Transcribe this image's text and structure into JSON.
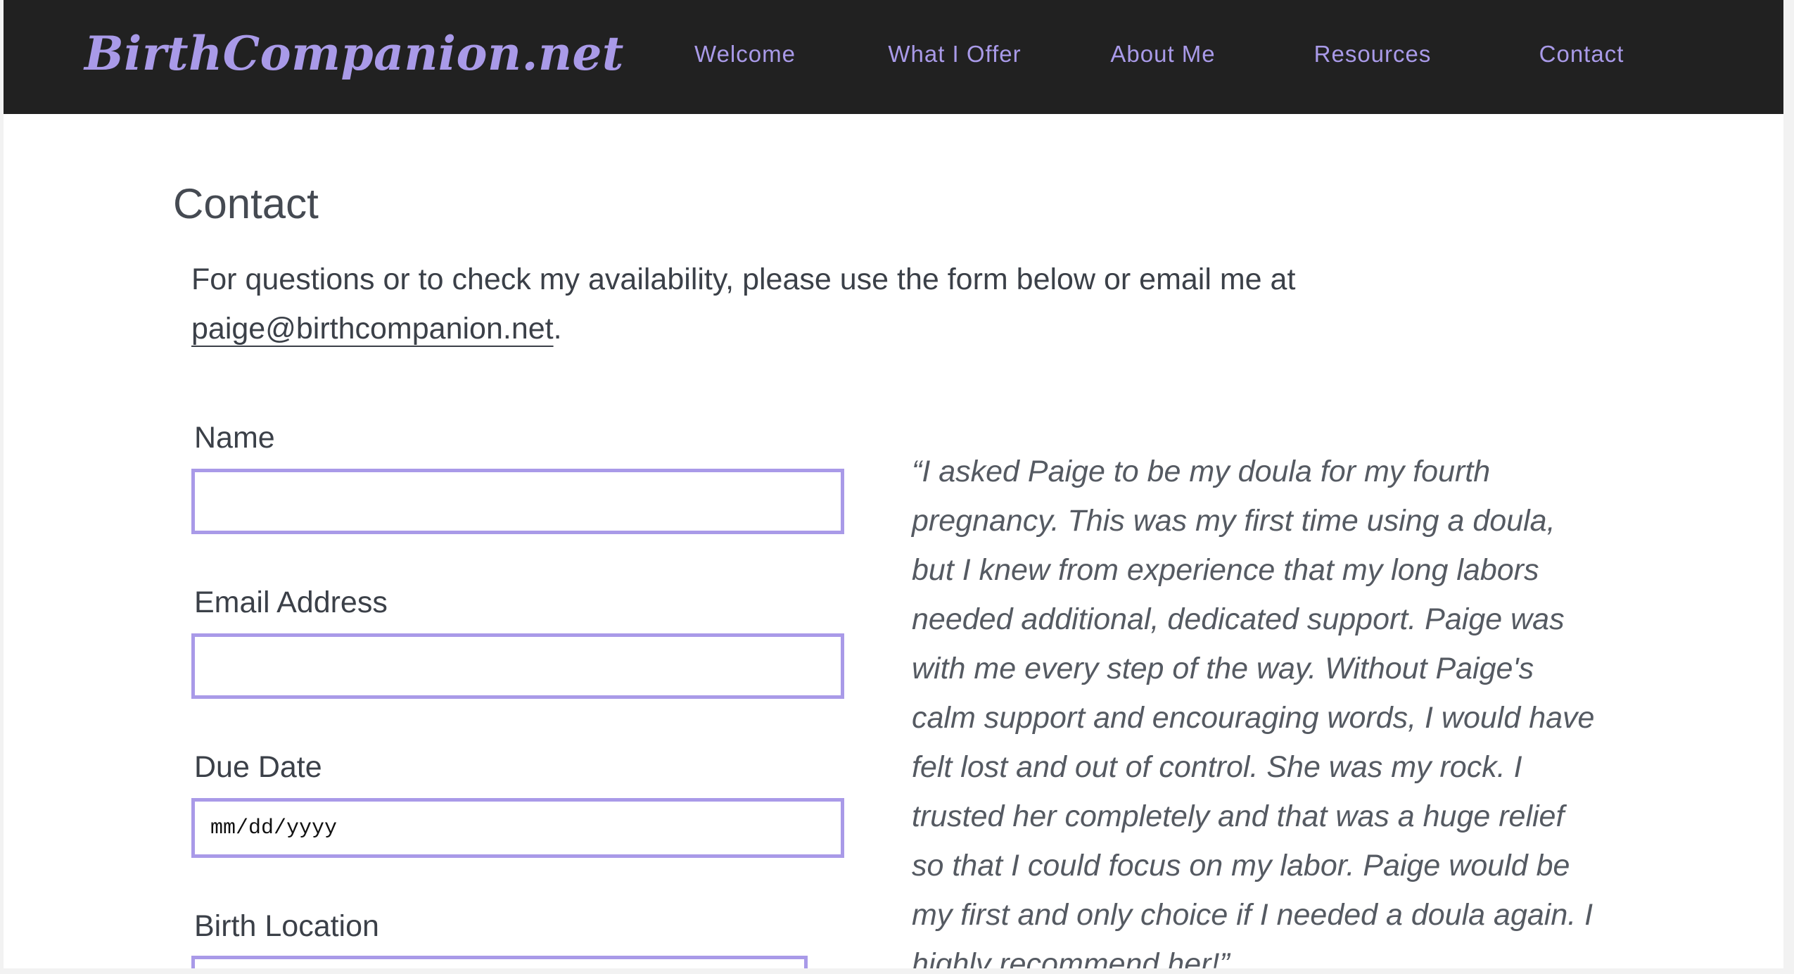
{
  "site": {
    "brand": "BirthCompanion.net"
  },
  "nav": {
    "items": [
      {
        "label": "Welcome"
      },
      {
        "label": "What I Offer"
      },
      {
        "label": "About Me"
      },
      {
        "label": "Resources"
      },
      {
        "label": "Contact"
      }
    ]
  },
  "main": {
    "title": "Contact",
    "intro": {
      "text": "For questions or to check my availability, please use the form below or email me at ",
      "email": "paige@birthcompanion.net",
      "suffix": "."
    },
    "form": {
      "name_label": "Name",
      "name_value": "",
      "email_label": "Email Address",
      "email_value": "",
      "due_date_label": "Due Date",
      "due_date_placeholder": "mm/dd/yyyy",
      "birth_location_label": "Birth Location",
      "birth_location_value": ""
    },
    "testimonial": "“I asked Paige to be my doula for my fourth pregnancy. This was my first time using a doula, but I knew from experience that my long labors needed additional, dedicated support. Paige was with me every step of the way. Without Paige's calm support and encouraging words, I would have felt lost and out of control. She was my rock. I trusted her completely and that was a huge relief so that I could focus on my labor. Paige would be my first and only choice if I needed a doula again. I highly recommend her!”"
  },
  "colors": {
    "navbar_bg": "#212121",
    "accent": "#a99ae8",
    "text": "#3b4048",
    "quote_text": "#555a62"
  }
}
